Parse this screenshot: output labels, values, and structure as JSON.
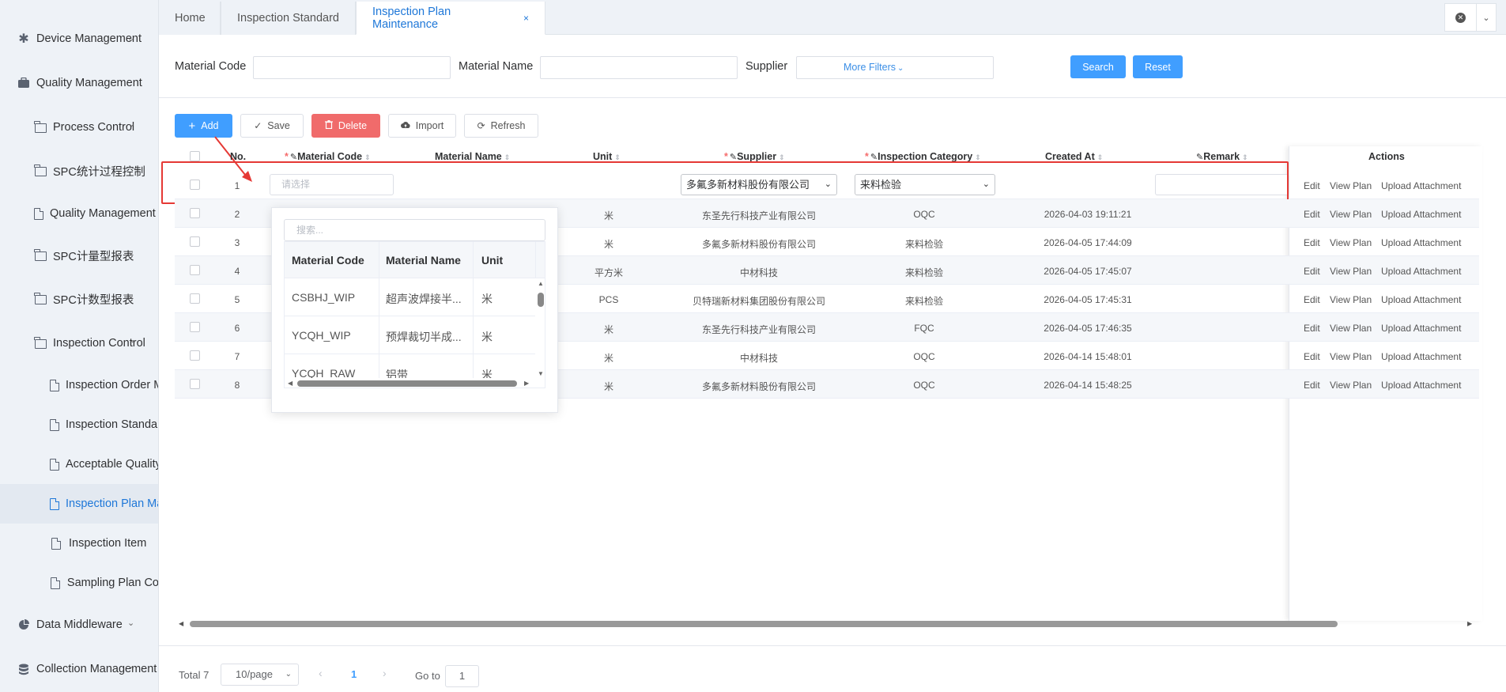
{
  "sidebar": {
    "items": [
      {
        "label": "Device Management",
        "icon": "asterisk-icon"
      },
      {
        "label": "Quality Management",
        "icon": "briefcase-icon"
      },
      {
        "label": "Process Control",
        "icon": "folder-icon"
      },
      {
        "label": "SPC统计过程控制",
        "icon": "folder-icon"
      },
      {
        "label": "Quality Management I",
        "icon": "file-icon"
      },
      {
        "label": "SPC计量型报表",
        "icon": "folder-icon"
      },
      {
        "label": "SPC计数型报表",
        "icon": "folder-icon"
      },
      {
        "label": "Inspection Control",
        "icon": "folder-icon"
      },
      {
        "label": "Inspection Order M",
        "icon": "file-icon"
      },
      {
        "label": "Inspection Standar",
        "icon": "file-icon"
      },
      {
        "label": "Acceptable Quality",
        "icon": "file-icon"
      },
      {
        "label": "Inspection Plan Ma",
        "icon": "file-icon"
      },
      {
        "label": "Inspection Item",
        "icon": "file-icon"
      },
      {
        "label": "Sampling Plan Co",
        "icon": "file-icon"
      },
      {
        "label": "Data Middleware",
        "icon": "pie-icon"
      },
      {
        "label": "Collection Management",
        "icon": "database-icon"
      }
    ]
  },
  "tabs": [
    {
      "label": "Home"
    },
    {
      "label": "Inspection Standard"
    },
    {
      "label": "Inspection Plan Maintenance"
    }
  ],
  "tab_close": "×",
  "filters": {
    "material_code_label": "Material Code",
    "material_name_label": "Material Name",
    "supplier_label": "Supplier",
    "more_filters": "More Filters",
    "search": "Search",
    "reset": "Reset"
  },
  "toolbar": {
    "add": "Add",
    "save": "Save",
    "delete": "Delete",
    "import": "Import",
    "refresh": "Refresh"
  },
  "table": {
    "headers": {
      "no": "No.",
      "material_code": "Material Code",
      "material_name": "Material Name",
      "unit": "Unit",
      "supplier": "Supplier",
      "inspection_category": "Inspection Category",
      "created_at": "Created At",
      "remark": "Remark",
      "actions": "Actions"
    },
    "edit_row": {
      "no": "1",
      "material_code_placeholder": "请选择",
      "supplier": "多氟多新材料股份有限公司",
      "inspection_category": "来料检验"
    },
    "rows": [
      {
        "no": "2",
        "unit": "米",
        "supplier": "东圣先行科技产业有限公司",
        "category": "OQC",
        "created": "2026-04-03 19:11:21"
      },
      {
        "no": "3",
        "unit": "米",
        "supplier": "多氟多新材料股份有限公司",
        "category": "来料检验",
        "created": "2026-04-05 17:44:09"
      },
      {
        "no": "4",
        "unit": "平方米",
        "supplier": "中材科技",
        "category": "来料检验",
        "created": "2026-04-05 17:45:07"
      },
      {
        "no": "5",
        "unit": "PCS",
        "supplier": "贝特瑞新材料集团股份有限公司",
        "category": "来料检验",
        "created": "2026-04-05 17:45:31"
      },
      {
        "no": "6",
        "unit": "米",
        "supplier": "东圣先行科技产业有限公司",
        "category": "FQC",
        "created": "2026-04-05 17:46:35"
      },
      {
        "no": "7",
        "unit": "米",
        "supplier": "中材科技",
        "category": "OQC",
        "created": "2026-04-14 15:48:01"
      },
      {
        "no": "8",
        "unit": "米",
        "supplier": "多氟多新材料股份有限公司",
        "category": "OQC",
        "created": "2026-04-14 15:48:25"
      }
    ],
    "actions": {
      "edit": "Edit",
      "view_plan": "View Plan",
      "upload": "Upload Attachment"
    }
  },
  "popup": {
    "search_placeholder": "搜索...",
    "headers": {
      "code": "Material Code",
      "name": "Material Name",
      "unit": "Unit"
    },
    "rows": [
      {
        "code": "CSBHJ_WIP",
        "name": "超声波焊接半...",
        "unit": "米"
      },
      {
        "code": "YCQH_WIP",
        "name": "预焊裁切半成...",
        "unit": "米"
      },
      {
        "code": "YCQH_RAW",
        "name": "铝带",
        "unit": "米"
      }
    ]
  },
  "pagination": {
    "total": "Total 7",
    "page_size": "10/page",
    "current_page": "1",
    "goto_label": "Go to",
    "goto_value": "1"
  },
  "colors": {
    "primary": "#409eff",
    "danger": "#f06b6b",
    "highlight": "#e53935",
    "active_link": "#1e77d8"
  }
}
